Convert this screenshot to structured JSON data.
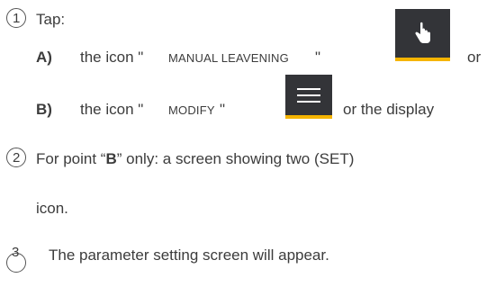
{
  "steps": [
    {
      "number": "1",
      "text": "Tap:"
    },
    {
      "number": "2",
      "text_before": "For point “",
      "text_bold": "B",
      "text_after": "” only: a screen showing two (SET)",
      "text_line2": "icon."
    },
    {
      "number": "3",
      "text": "The parameter setting screen will appear."
    }
  ],
  "option_a": {
    "label": "A)",
    "prefix": "the icon \"",
    "name": "MANUAL LEAVENING",
    "suffix": "\"",
    "trailing": "or",
    "icon": "hand-pointer-icon"
  },
  "option_b": {
    "label": "B)",
    "prefix": "the icon \"",
    "name": "MODIFY",
    "suffix": "\"",
    "trailing": "or the display",
    "icon": "hamburger-menu-icon"
  },
  "colors": {
    "icon_background": "#333438",
    "icon_accent": "#f5b400",
    "text": "#3c3c3c"
  }
}
